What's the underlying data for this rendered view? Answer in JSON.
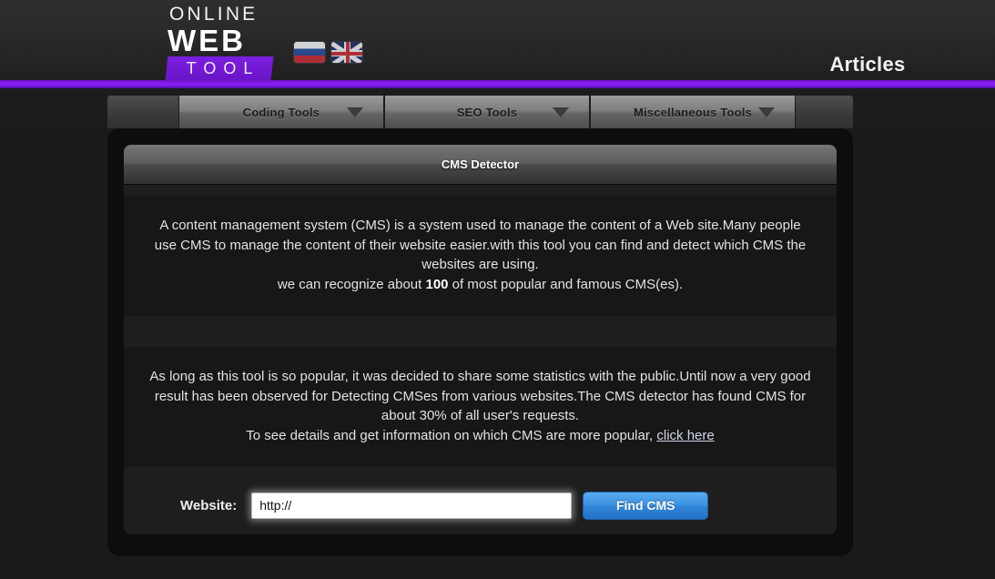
{
  "header": {
    "logo": {
      "line1": "ONLINE",
      "line2": "WEB",
      "line3": "TOOL"
    },
    "flags": [
      {
        "name": "russian-flag",
        "label": "Русский"
      },
      {
        "name": "english-flag",
        "label": "English"
      }
    ],
    "articles_label": "Articles",
    "accent_color": "#7b1ce8"
  },
  "nav": {
    "items": [
      {
        "label": "Coding Tools",
        "icon": "chevron-down-icon"
      },
      {
        "label": "SEO Tools",
        "icon": "chevron-down-icon"
      },
      {
        "label": "Miscellaneous Tools",
        "icon": "chevron-down-icon"
      }
    ]
  },
  "panel": {
    "title": "CMS Detector",
    "intro": {
      "line1": "A content management system (CMS) is a system used to manage the content of a Web site.Many people use CMS to manage the content of their website easier.with this tool you can find and detect which CMS the websites are using.",
      "line2_prefix": "we can recognize about ",
      "line2_count": "100",
      "line2_suffix": " of most popular and famous CMS(es)."
    },
    "stats": {
      "line1": "As long as this tool is so popular, it was decided to share some statistics with the public.Until now a very good result has been observed for Detecting CMSes from various websites.The CMS detector has found CMS for about 30% of all user's requests.",
      "line2_prefix": "To see details and get information on which CMS are more popular, ",
      "link_text": "click here"
    },
    "form": {
      "label": "Website:",
      "input_value": "http://",
      "input_placeholder": "http://",
      "submit_label": "Find CMS",
      "submit_color": "#2f83d6"
    }
  }
}
